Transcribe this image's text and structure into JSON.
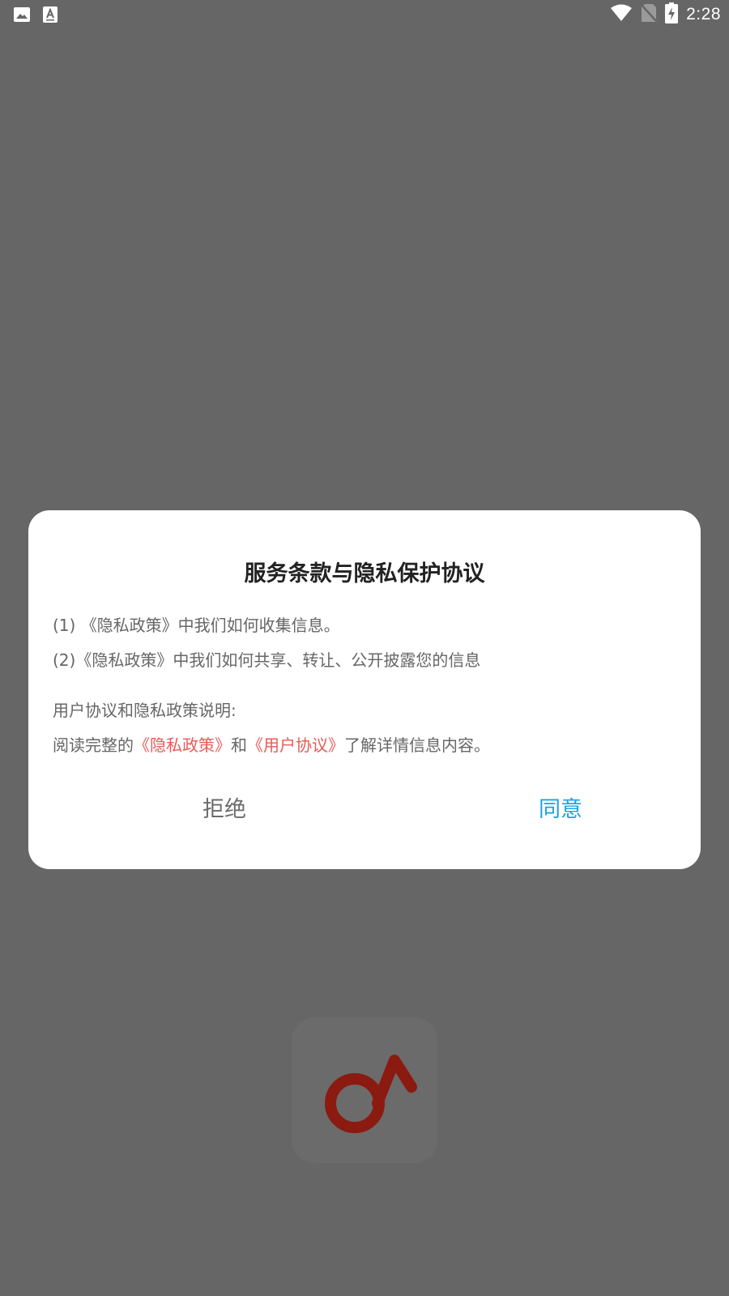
{
  "status_bar": {
    "left_icons": [
      "image-icon",
      "font-a-icon"
    ],
    "right_icons": [
      "wifi-icon",
      "no-sim-icon",
      "battery-charging-icon"
    ],
    "time": "2:28"
  },
  "splash": {
    "icon": "music-note-icon",
    "color": "#8b1a10"
  },
  "dialog": {
    "title": "服务条款与隐私保护协议",
    "line1": "(1) 《隐私政策》中我们如何收集信息。",
    "line2": "(2)《隐私政策》中我们如何共享、转让、公开披露您的信息",
    "line3": "用户协议和隐私政策说明:",
    "line4": {
      "prefix": "阅读完整的",
      "link_privacy": "《隐私政策》",
      "middle": "和",
      "link_user": "《用户协议》",
      "suffix": "了解详情信息内容。"
    },
    "reject_label": "拒绝",
    "agree_label": "同意",
    "link_color": "#e85a55",
    "agree_color": "#19a3e0"
  }
}
